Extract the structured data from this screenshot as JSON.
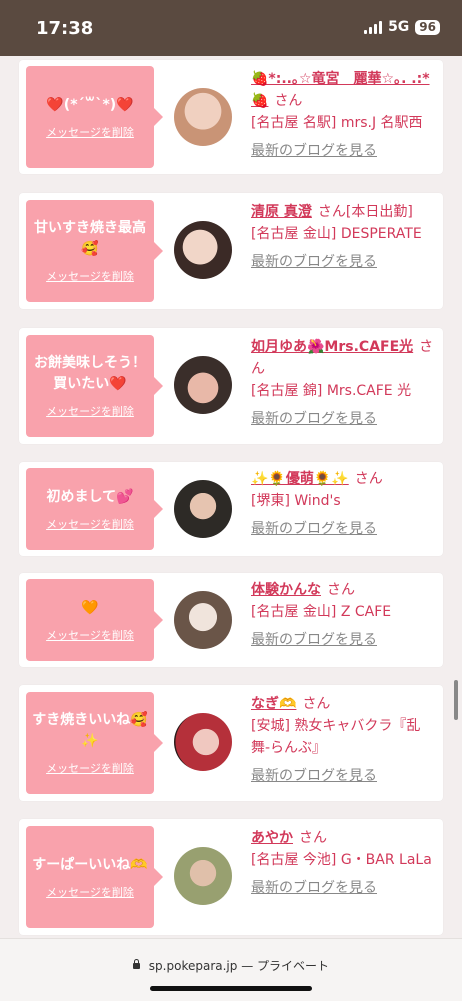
{
  "status_bar": {
    "time": "17:38",
    "network": "5G",
    "battery": "96"
  },
  "delete_label": "メッセージを削除",
  "blog_label": "最新のブログを見る",
  "cards": [
    {
      "message": "❤️(*´꒳`*)❤️",
      "name": "🍓*:..｡☆竜宮　麗華☆｡. .:*🍓",
      "honorific": "さん",
      "shop": "[名古屋 名駅] mrs.J 名駅西",
      "avatar_color": "#c99476"
    },
    {
      "message": "甘いすき焼き最高🥰",
      "name": "清原 真澄",
      "honorific": "さん[本日出勤]",
      "shop": "[名古屋 金山] DESPERATE",
      "avatar_color": "#d9b2a0"
    },
    {
      "message": "お餅美味しそう！買いたい❤️",
      "name": "如月ゆあ🌺Mrs.CAFE光",
      "honorific": "さん",
      "shop": "[名古屋 錦] Mrs.CAFE 光",
      "avatar_color": "#5b4b42"
    },
    {
      "message": "初めまして💕",
      "name": "✨🌻優萌🌻✨",
      "honorific": "さん",
      "shop": "[堺東] Wind's",
      "avatar_color": "#6e6a5e"
    },
    {
      "message": "🧡",
      "name": "体験かんな",
      "honorific": "さん",
      "shop": "[名古屋 金山] Z CAFE",
      "avatar_color": "#9a8272"
    },
    {
      "message": "すき焼きいいね🥰✨",
      "name": "なぎ🫶",
      "honorific": "さん",
      "shop": "[安城] 熟女キャバクラ『乱舞-らんぶ』",
      "avatar_color": "#b5303a"
    },
    {
      "message": "すーぱーいいね🫶",
      "name": "あやか",
      "honorific": "さん",
      "shop": "[名古屋 今池] G・BAR LaLa",
      "avatar_color": "#98a070"
    }
  ],
  "url_bar": {
    "domain": "sp.pokepara.jp",
    "mode": "— プライベート"
  },
  "colors": {
    "accent": "#d2395a",
    "bubble": "#f9a2ac"
  }
}
